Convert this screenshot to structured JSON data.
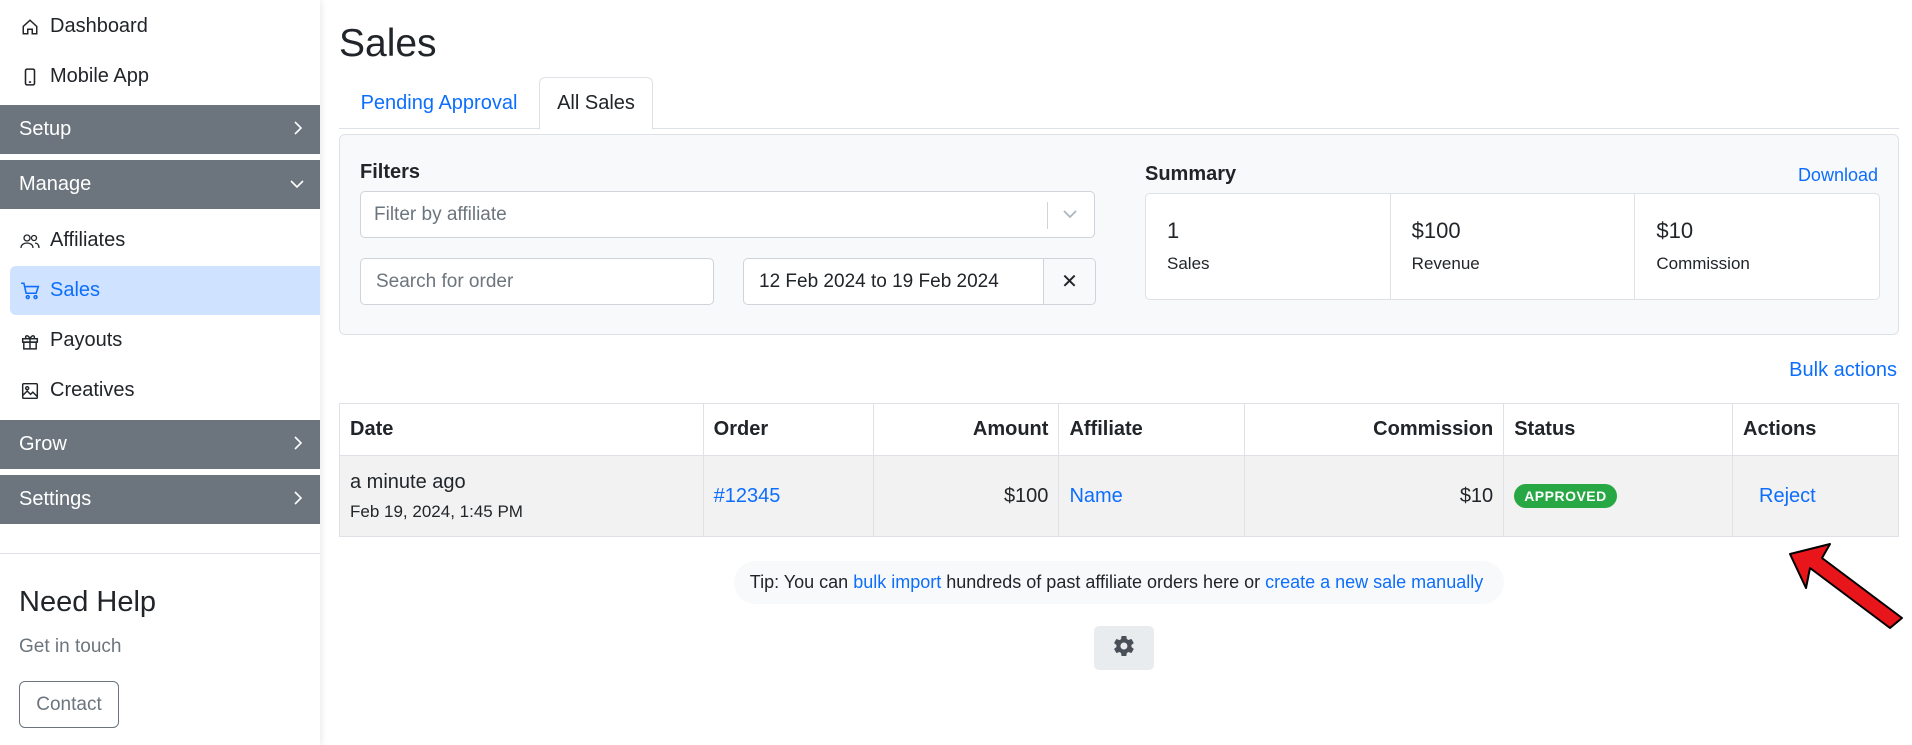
{
  "sidebar": {
    "top_links": [
      {
        "label": "Dashboard",
        "icon": "home-icon"
      },
      {
        "label": "Mobile App",
        "icon": "mobile-icon"
      }
    ],
    "groups": {
      "setup": "Setup",
      "manage": "Manage",
      "grow": "Grow",
      "settings": "Settings"
    },
    "manage_items": [
      {
        "label": "Affiliates",
        "icon": "users-icon"
      },
      {
        "label": "Sales",
        "icon": "cart-icon",
        "active": true
      },
      {
        "label": "Payouts",
        "icon": "gift-icon"
      },
      {
        "label": "Creatives",
        "icon": "image-icon"
      }
    ],
    "help": {
      "title": "Need Help",
      "subtitle": "Get in touch",
      "contact_label": "Contact"
    }
  },
  "page": {
    "title": "Sales",
    "tabs": [
      "Pending Approval",
      "All Sales"
    ]
  },
  "filters": {
    "label": "Filters",
    "affiliate_placeholder": "Filter by affiliate",
    "order_placeholder": "Search for order",
    "date_range": "12 Feb 2024 to 19 Feb 2024",
    "clear_symbol": "✕"
  },
  "summary": {
    "label": "Summary",
    "download_label": "Download",
    "cells": [
      {
        "value": "1",
        "label": "Sales"
      },
      {
        "value": "$100",
        "label": "Revenue"
      },
      {
        "value": "$10",
        "label": "Commission"
      }
    ]
  },
  "bulk_actions_label": "Bulk actions",
  "table": {
    "headers": [
      "Date",
      "Order",
      "Amount",
      "Affiliate",
      "Commission",
      "Status",
      "Actions"
    ],
    "rows": [
      {
        "date_relative": "a minute ago",
        "date_full": "Feb 19, 2024, 1:45 PM",
        "order": "#12345",
        "amount": "$100",
        "affiliate": "Name",
        "commission": "$10",
        "status": "APPROVED",
        "action": "Reject"
      }
    ]
  },
  "tip": {
    "prefix": "Tip: You can",
    "link1": "bulk import",
    "middle": "hundreds of past affiliate orders here or",
    "link2": "create a new sale manually"
  },
  "colors": {
    "accent": "#0d6efd",
    "group_bg": "#6c757d",
    "active_bg": "#cfe2ff",
    "approved": "#28a745",
    "arrow": "#e8151b"
  }
}
